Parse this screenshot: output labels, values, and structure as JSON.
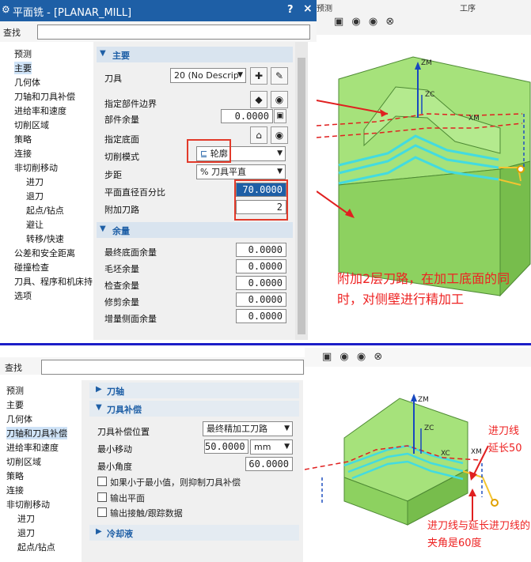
{
  "top": {
    "window_icon": "⚙",
    "title": "平面铣 - [PLANAR_MILL]",
    "help_label": "?",
    "close_label": "×",
    "bg_labels": {
      "left": "预测",
      "right": "工序"
    },
    "search_label": "查找",
    "search_value": "",
    "nav": [
      "预测",
      "主要",
      "几何体",
      "刀轴和刀具补偿",
      "进给率和速度",
      "切削区域",
      "策略",
      "连接",
      "非切削移动",
      "进刀",
      "退刀",
      "起点/钻点",
      "避让",
      "转移/快速",
      "公差和安全距离",
      "碰撞检查",
      "刀具、程序和机床持",
      "选项"
    ],
    "nav_selected": "主要",
    "main_section": "主要",
    "tool_label": "刀具",
    "tool_value": "20 (No Descrip",
    "part_boundary_label": "指定部件边界",
    "part_stock_label": "部件余量",
    "part_stock_value": "0.0000",
    "floor_label": "指定底面",
    "cut_pattern_label": "切削模式",
    "cut_pattern_value": "轮廓",
    "stepover_label": "步距",
    "stepover_value": "% 刀具平直",
    "flat_pct_label": "平面直径百分比",
    "flat_pct_value": "70.0000",
    "add_passes_label": "附加刀路",
    "add_passes_value": "2",
    "stock_section": "余量",
    "stock_rows": [
      {
        "label": "最终底面余量",
        "value": "0.0000"
      },
      {
        "label": "毛坯余量",
        "value": "0.0000"
      },
      {
        "label": "检查余量",
        "value": "0.0000"
      },
      {
        "label": "修剪余量",
        "value": "0.0000"
      },
      {
        "label": "增量侧面余量",
        "value": "0.0000"
      }
    ],
    "axis_labels": {
      "zm": "ZM",
      "zc": "ZC",
      "xm": "XM"
    },
    "annotation": "附加2层刀路，在加工底面的同时，对侧壁进行精加工"
  },
  "bottom": {
    "search_label": "查找",
    "search_value": "",
    "nav": [
      "预测",
      "主要",
      "几何体",
      "刀轴和刀具补偿",
      "进给率和速度",
      "切削区域",
      "策略",
      "连接",
      "非切削移动",
      "进刀",
      "退刀",
      "起点/钻点"
    ],
    "nav_selected": "刀轴和刀具补偿",
    "tool_axis_section": "刀轴",
    "comp_section": "刀具补偿",
    "comp_pos_label": "刀具补偿位置",
    "comp_pos_value": "最终精加工刀路",
    "min_move_label": "最小移动",
    "min_move_value": "50.0000",
    "min_move_unit": "mm",
    "min_angle_label": "最小角度",
    "min_angle_value": "60.0000",
    "check_suppress": "如果小于最小值，则抑制刀具补偿",
    "check_output_plane": "输出平面",
    "check_output_contact": "输出接触/跟踪数据",
    "coolant_section": "冷却液",
    "axis_labels": {
      "zm": "ZM",
      "zc": "ZC",
      "xc": "XC",
      "xm": "XM"
    },
    "annotation_top": "进刀线\n延长50",
    "annotation_bottom": "进刀线与延长进刀线的夹角是60度"
  },
  "colors": {
    "accent": "#1e5fa6",
    "annotation": "#e22222",
    "model": "#8fd66a",
    "toolpath": "#43dbe0",
    "divider": "#1c1ec8"
  }
}
